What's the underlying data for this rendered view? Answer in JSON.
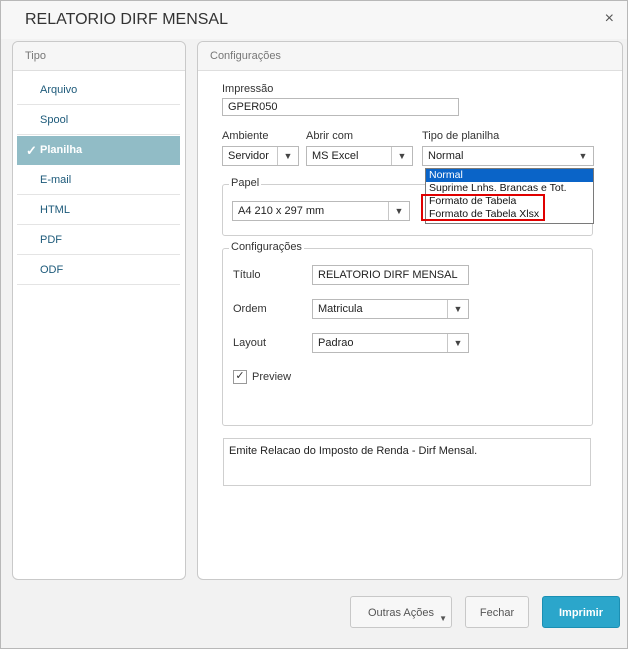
{
  "window": {
    "title": "RELATORIO DIRF MENSAL",
    "close_glyph": "×"
  },
  "left_panel": {
    "header": "Tipo",
    "items": [
      {
        "label": "Arquivo",
        "active": false
      },
      {
        "label": "Spool",
        "active": false
      },
      {
        "label": "Planilha",
        "active": true
      },
      {
        "label": "E-mail",
        "active": false
      },
      {
        "label": "HTML",
        "active": false
      },
      {
        "label": "PDF",
        "active": false
      },
      {
        "label": "ODF",
        "active": false
      }
    ]
  },
  "right_panel": {
    "header": "Configurações",
    "impressao": {
      "label": "Impressão",
      "value": "GPER050"
    },
    "ambiente": {
      "label": "Ambiente",
      "value": "Servidor"
    },
    "abrir_com": {
      "label": "Abrir com",
      "value": "MS Excel"
    },
    "tipo_planilha": {
      "label": "Tipo de planilha",
      "value": "Normal",
      "options": [
        "Normal",
        "Suprime Lnhs. Brancas e Tot.",
        "Formato de Tabela",
        "Formato de Tabela Xlsx"
      ],
      "selected_index": 0
    },
    "papel": {
      "legend": "Papel",
      "value": "A4 210 x 297 mm"
    },
    "config_group": {
      "legend": "Configurações",
      "titulo": {
        "label": "Título",
        "value": "RELATORIO DIRF MENSAL"
      },
      "ordem": {
        "label": "Ordem",
        "value": "Matricula"
      },
      "layout": {
        "label": "Layout",
        "value": "Padrao"
      },
      "preview": {
        "label": "Preview",
        "checked": true
      }
    },
    "description": "Emite Relacao do Imposto de Renda - Dirf Mensal."
  },
  "footer": {
    "other_actions": "Outras Ações",
    "close": "Fechar",
    "print": "Imprimir"
  },
  "colors": {
    "accent": "#2ba6cb",
    "nav_active": "#91bcc6",
    "highlight": "#e00000",
    "list_selected": "#0a64c8"
  }
}
